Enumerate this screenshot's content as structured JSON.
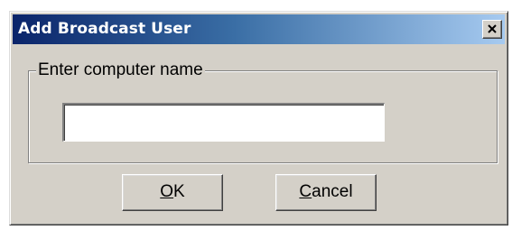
{
  "dialog": {
    "title": "Add Broadcast User",
    "close_icon": "close-icon"
  },
  "group": {
    "label": "Enter computer name"
  },
  "input": {
    "value": "",
    "placeholder": ""
  },
  "buttons": {
    "ok": {
      "mnemonic": "O",
      "rest": "K"
    },
    "cancel": {
      "mnemonic": "C",
      "rest": "ancel"
    }
  },
  "colors": {
    "titlebar_start": "#0a246a",
    "titlebar_end": "#a6caf0",
    "face": "#d4d0c8"
  }
}
